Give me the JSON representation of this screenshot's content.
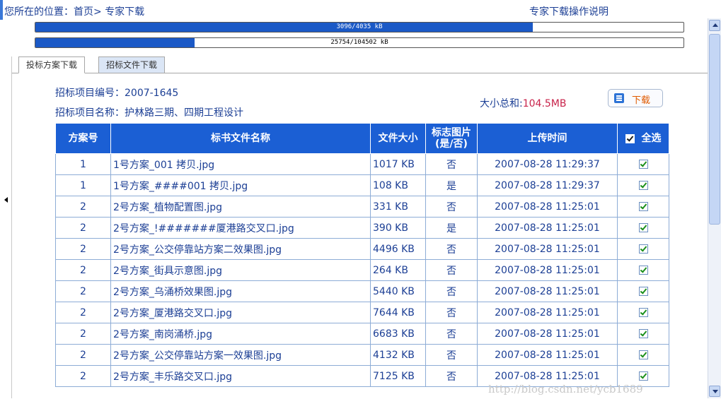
{
  "breadcrumb": {
    "prefix": "您所在的位置：",
    "home": "首页",
    "separator": "> ",
    "current": "专家下载"
  },
  "help_link": "专家下载操作说明",
  "progress_bars": [
    {
      "text": "3096/4035 kB",
      "fraction": 0.767
    },
    {
      "text": "25754/104502 kB",
      "fraction": 0.246
    }
  ],
  "tabs": [
    {
      "label": "投标方案下载",
      "active": true
    },
    {
      "label": "招标文件下载",
      "active": false
    }
  ],
  "project": {
    "number_label": "招标项目编号：",
    "number_value": "2007-1645",
    "name_label": "招标项目名称：",
    "name_value": "护林路三期、四期工程设计"
  },
  "total": {
    "label": "大小总和:",
    "value": "104.5MB"
  },
  "download_button": {
    "label": "下载",
    "icon": "download-list-icon",
    "label_color": "#e05a00"
  },
  "table": {
    "headers": {
      "scheme": "方案号",
      "filename": "标书文件名称",
      "size": "文件大小",
      "flag": "标志图片(是/否)",
      "uploaded": "上传时间",
      "select_all": "全选"
    },
    "rows": [
      {
        "scheme": "1",
        "filename": "1号方案_001 拷贝.jpg",
        "size": "1017 KB",
        "flag": "否",
        "uploaded": "2007-08-28 11:29:37",
        "checked": true
      },
      {
        "scheme": "1",
        "filename": "1号方案_####001 拷贝.jpg",
        "size": "108 KB",
        "flag": "是",
        "uploaded": "2007-08-28 11:29:37",
        "checked": true
      },
      {
        "scheme": "2",
        "filename": "2号方案_植物配置图.jpg",
        "size": "331 KB",
        "flag": "否",
        "uploaded": "2007-08-28 11:25:01",
        "checked": true
      },
      {
        "scheme": "2",
        "filename": "2号方案_!#######厦港路交叉口.jpg",
        "size": "390 KB",
        "flag": "是",
        "uploaded": "2007-08-28 11:25:01",
        "checked": true
      },
      {
        "scheme": "2",
        "filename": "2号方案_公交停靠站方案二效果图.jpg",
        "size": "4496 KB",
        "flag": "否",
        "uploaded": "2007-08-28 11:25:01",
        "checked": true
      },
      {
        "scheme": "2",
        "filename": "2号方案_街具示意图.jpg",
        "size": "264 KB",
        "flag": "否",
        "uploaded": "2007-08-28 11:25:01",
        "checked": true
      },
      {
        "scheme": "2",
        "filename": "2号方案_乌涌桥效果图.jpg",
        "size": "5440 KB",
        "flag": "否",
        "uploaded": "2007-08-28 11:25:01",
        "checked": true
      },
      {
        "scheme": "2",
        "filename": "2号方案_厦港路交叉口.jpg",
        "size": "7644 KB",
        "flag": "否",
        "uploaded": "2007-08-28 11:25:01",
        "checked": true
      },
      {
        "scheme": "2",
        "filename": "2号方案_南岗涌桥.jpg",
        "size": "6683 KB",
        "flag": "否",
        "uploaded": "2007-08-28 11:25:01",
        "checked": true
      },
      {
        "scheme": "2",
        "filename": "2号方案_公交停靠站方案一效果图.jpg",
        "size": "4132 KB",
        "flag": "否",
        "uploaded": "2007-08-28 11:25:01",
        "checked": true
      },
      {
        "scheme": "2",
        "filename": "2号方案_丰乐路交叉口.jpg",
        "size": "7125 KB",
        "flag": "否",
        "uploaded": "2007-08-28 11:25:01",
        "checked": true
      }
    ]
  },
  "watermark": "http://blog.csdn.net/ycb1689",
  "colors": {
    "accent": "#1b5fd4",
    "link_text": "#1c3f95",
    "total_value": "#c8234a"
  }
}
